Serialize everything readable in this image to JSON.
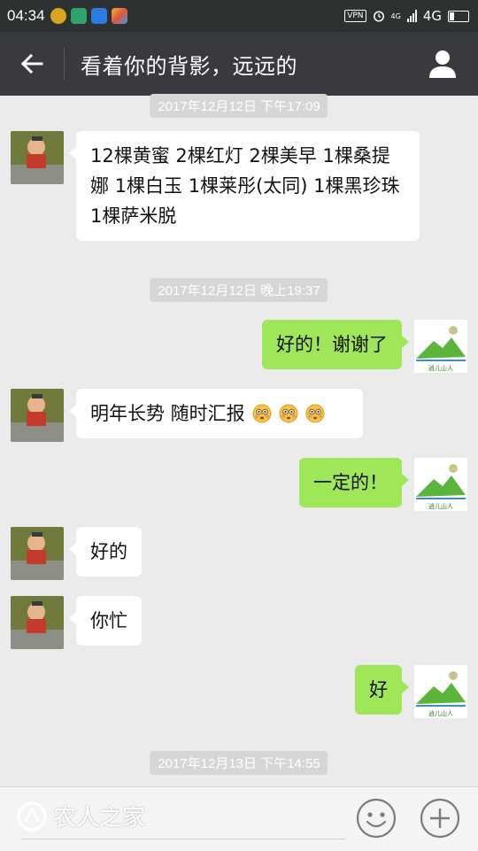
{
  "status_bar": {
    "time": "04:34",
    "vpn": "VPN",
    "network": "4G",
    "network_small": "4G"
  },
  "header": {
    "title": "看着你的背影，远远的"
  },
  "messages": [
    {
      "type": "timestamp",
      "text": "2017年12月12日 下午17:09"
    },
    {
      "type": "incoming",
      "text": "12棵黄蜜 2棵红灯 2棵美早 1棵桑提娜 1棵白玉 1棵莱彤(太同) 1棵黑珍珠 1棵萨米脱"
    },
    {
      "type": "timestamp",
      "text": "2017年12月12日 晚上19:37"
    },
    {
      "type": "outgoing",
      "text": "好的！谢谢了"
    },
    {
      "type": "incoming",
      "text": "明年长势 随时汇报",
      "emoji_count": 3
    },
    {
      "type": "outgoing",
      "text": "一定的！"
    },
    {
      "type": "incoming",
      "text": "好的"
    },
    {
      "type": "incoming",
      "text": "你忙"
    },
    {
      "type": "outgoing",
      "text": "好"
    },
    {
      "type": "timestamp",
      "text": "2017年12月13日 下午14:55"
    }
  ],
  "avatars": {
    "outgoing_caption": "逍儿山人"
  },
  "input_bar": {
    "watermark": "农人之家"
  },
  "icons": {
    "back": "arrow-left-icon",
    "profile": "person-icon",
    "emoji": "smiley-face-icon",
    "plus": "plus-circle-icon"
  },
  "colors": {
    "status_bar": "#2e3132",
    "title_bar": "#393a3f",
    "chat_background": "#ebebeb",
    "incoming_bubble": "#ffffff",
    "outgoing_bubble": "#9fe658",
    "timestamp_bg": "#d6d6d6"
  }
}
